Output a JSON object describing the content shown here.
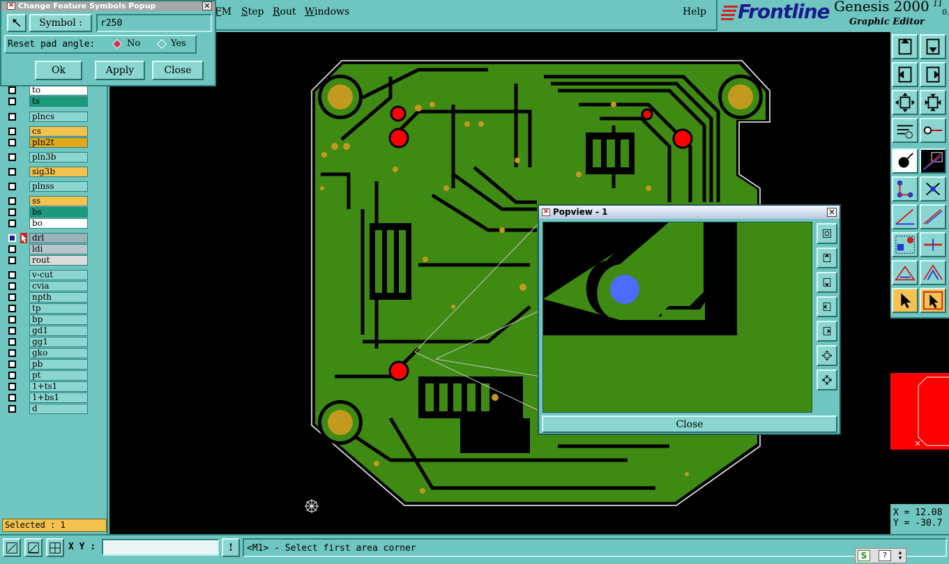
{
  "menu": {
    "items": [
      {
        "label": "FM",
        "underline": "F"
      },
      {
        "label": "Step",
        "underline": "S"
      },
      {
        "label": "Rout",
        "underline": "R"
      },
      {
        "label": "Windows",
        "underline": "W"
      }
    ],
    "help": "Help"
  },
  "brand": {
    "logo": "Frontline",
    "product": "Genesis 2000",
    "version_top": "11",
    "version_bottom": "0.",
    "subtitle": "Graphic Editor"
  },
  "popup": {
    "title": "Change Feature Symbols Popup",
    "symbol_label": "Symbol :",
    "symbol_value": "r250",
    "reset_label": "Reset pad angle:",
    "opt_no": "No",
    "opt_yes": "Yes",
    "selected_option": "No",
    "ok": "Ok",
    "apply": "Apply",
    "close": "Close"
  },
  "layers": [
    {
      "name": "to",
      "color": "#ffffff"
    },
    {
      "name": "ts",
      "color": "#1a9a7a"
    },
    {
      "name": "plncs",
      "color": "#8cd6d1"
    },
    {
      "name": "cs",
      "color": "#f4c24e"
    },
    {
      "name": "pln2t",
      "color": "#e0a91a"
    },
    {
      "name": "pln3b",
      "color": "#8cd6d1"
    },
    {
      "name": "sig3b",
      "color": "#f4c24e"
    },
    {
      "name": "plnss",
      "color": "#8cd6d1"
    },
    {
      "name": "ss",
      "color": "#f4c24e"
    },
    {
      "name": "bs",
      "color": "#1a9a7a"
    },
    {
      "name": "bo",
      "color": "#ffffff"
    },
    {
      "name": "drl",
      "color": "#9bb0b8"
    },
    {
      "name": "ldi",
      "color": "#b8c7cc"
    },
    {
      "name": "rout",
      "color": "#dcdcdc"
    },
    {
      "name": "v-cut",
      "color": "#8cd6d1"
    },
    {
      "name": "cvia",
      "color": "#8cd6d1"
    },
    {
      "name": "npth",
      "color": "#8cd6d1"
    },
    {
      "name": "tp",
      "color": "#8cd6d1"
    },
    {
      "name": "bp",
      "color": "#8cd6d1"
    },
    {
      "name": "gd1",
      "color": "#8cd6d1"
    },
    {
      "name": "gg1",
      "color": "#8cd6d1"
    },
    {
      "name": "gko",
      "color": "#8cd6d1"
    },
    {
      "name": "pb",
      "color": "#8cd6d1"
    },
    {
      "name": "pt",
      "color": "#8cd6d1"
    },
    {
      "name": "1+ts1",
      "color": "#8cd6d1"
    },
    {
      "name": "1+bs1",
      "color": "#8cd6d1"
    },
    {
      "name": "d",
      "color": "#8cd6d1"
    }
  ],
  "selected": "Selected : 1",
  "popview": {
    "title": "Popview - 1",
    "close": "Close"
  },
  "coords": {
    "x": "X = 12.08",
    "y": "Y = -30.7"
  },
  "bottom": {
    "xy_label": "X Y :",
    "xy_value": "",
    "status": "<M1> - Select first area corner"
  },
  "colors": {
    "ui_teal": "#6fc5c0",
    "board_green": "#3f8a12",
    "copper_pad": "#c49a1e",
    "drill_red": "#ff0000",
    "highlight_blue": "#4a6cff"
  }
}
